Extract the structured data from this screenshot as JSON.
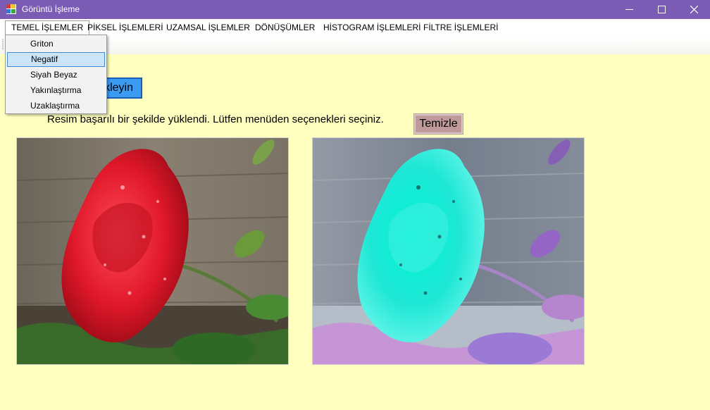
{
  "window": {
    "title": "Görüntü İşleme"
  },
  "menubar": {
    "items": [
      {
        "label": "TEMEL İŞLEMLER"
      },
      {
        "label": "PİKSEL İŞLEMLERİ"
      },
      {
        "label": "UZAMSAL İŞLEMLER"
      },
      {
        "label": "DÖNÜŞÜMLER"
      },
      {
        "label": "HİSTOGRAM İŞLEMLERİ"
      },
      {
        "label": "FİLTRE İŞLEMLERİ"
      }
    ]
  },
  "dropdown": {
    "items": [
      {
        "label": "Griton"
      },
      {
        "label": "Negatif"
      },
      {
        "label": "Siyah Beyaz"
      },
      {
        "label": "Yakınlaştırma"
      },
      {
        "label": "Uzaklaştırma"
      }
    ],
    "highlighted": "Negatif"
  },
  "upload_button": {
    "label": "kleyin"
  },
  "status": {
    "text": "Resim başarılı bir şekilde yüklendi. Lütfen menüden seçenekleri seçiniz."
  },
  "clear_button": {
    "label": "Temizle"
  },
  "colors": {
    "titlebar": "#7a5cb4",
    "background": "#ffffc0",
    "upload_button": "#3b9af2",
    "clear_button": "#c09a9a",
    "menu_highlight": "#cce4f7"
  },
  "icons": {
    "app": "app-icon",
    "minimize": "minimize-icon",
    "maximize": "maximize-icon",
    "close": "close-icon"
  }
}
